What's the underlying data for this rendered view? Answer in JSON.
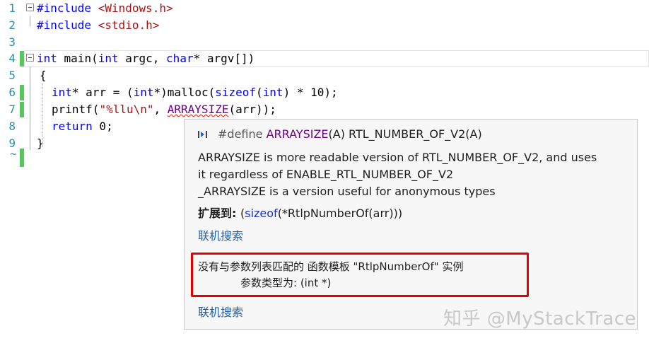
{
  "editor": {
    "lines": [
      {
        "n": "1",
        "tokens": [
          {
            "t": "#include ",
            "c": "kw"
          },
          {
            "t": "<Windows.h>",
            "c": "str"
          }
        ]
      },
      {
        "n": "2",
        "tokens": [
          {
            "t": "#include ",
            "c": "kw"
          },
          {
            "t": "<stdio.h>",
            "c": "str"
          }
        ]
      },
      {
        "n": "3",
        "tokens": []
      },
      {
        "n": "4",
        "tokens": [
          {
            "t": "int",
            "c": "kw"
          },
          {
            "t": " main(",
            "c": ""
          },
          {
            "t": "int",
            "c": "kw"
          },
          {
            "t": " argc, ",
            "c": ""
          },
          {
            "t": "char",
            "c": "kw"
          },
          {
            "t": "* argv[])",
            "c": ""
          }
        ]
      },
      {
        "n": "5",
        "tokens": [
          {
            "t": "{",
            "c": ""
          }
        ]
      },
      {
        "n": "6",
        "tokens": [
          {
            "t": "int",
            "c": "kw"
          },
          {
            "t": "* arr = (",
            "c": ""
          },
          {
            "t": "int",
            "c": "kw"
          },
          {
            "t": "*)malloc(",
            "c": ""
          },
          {
            "t": "sizeof",
            "c": "kw"
          },
          {
            "t": "(",
            "c": ""
          },
          {
            "t": "int",
            "c": "kw"
          },
          {
            "t": ") * 10);",
            "c": ""
          }
        ]
      },
      {
        "n": "7",
        "tokens": [
          {
            "t": "printf(",
            "c": ""
          },
          {
            "t": "\"%llu\\n\"",
            "c": "str"
          },
          {
            "t": ", ",
            "c": ""
          },
          {
            "t": "ARRAYSIZE",
            "c": "macro squig"
          },
          {
            "t": "(arr));",
            "c": ""
          }
        ]
      },
      {
        "n": "8",
        "tokens": [
          {
            "t": "return",
            "c": "kw"
          },
          {
            "t": " 0;",
            "c": ""
          }
        ]
      },
      {
        "n": "9",
        "tokens": [
          {
            "t": "}",
            "c": ""
          }
        ]
      }
    ],
    "tilde": "~"
  },
  "tooltip": {
    "signature_prefix": "#define ",
    "signature_macro": "ARRAYSIZE",
    "signature_rest": "(A) RTL_NUMBER_OF_V2(A)",
    "desc_line1": "ARRAYSIZE is more readable version of RTL_NUMBER_OF_V2, and uses",
    "desc_line2": "it regardless of ENABLE_RTL_NUMBER_OF_V2",
    "desc_line3": "_ARRAYSIZE is a version useful for anonymous types",
    "expand_label": "扩展到: ",
    "expand_open": "(",
    "expand_kw": "sizeof",
    "expand_rest": "(*RtlpNumberOf(arr)))",
    "search_link_1": "联机搜索",
    "error_line1": "没有与参数列表匹配的 函数模板 \"RtlpNumberOf\" 实例",
    "error_line2": "参数类型为:  (int *)",
    "search_link_2": "联机搜索"
  },
  "watermark": "知乎 @MyStackTrace",
  "colors": {
    "keyword": "#0000ff",
    "string": "#a31515",
    "macro": "#6f008a",
    "line_number": "#2b91af",
    "change_marker": "#57c65e",
    "error_box": "#e60000"
  }
}
